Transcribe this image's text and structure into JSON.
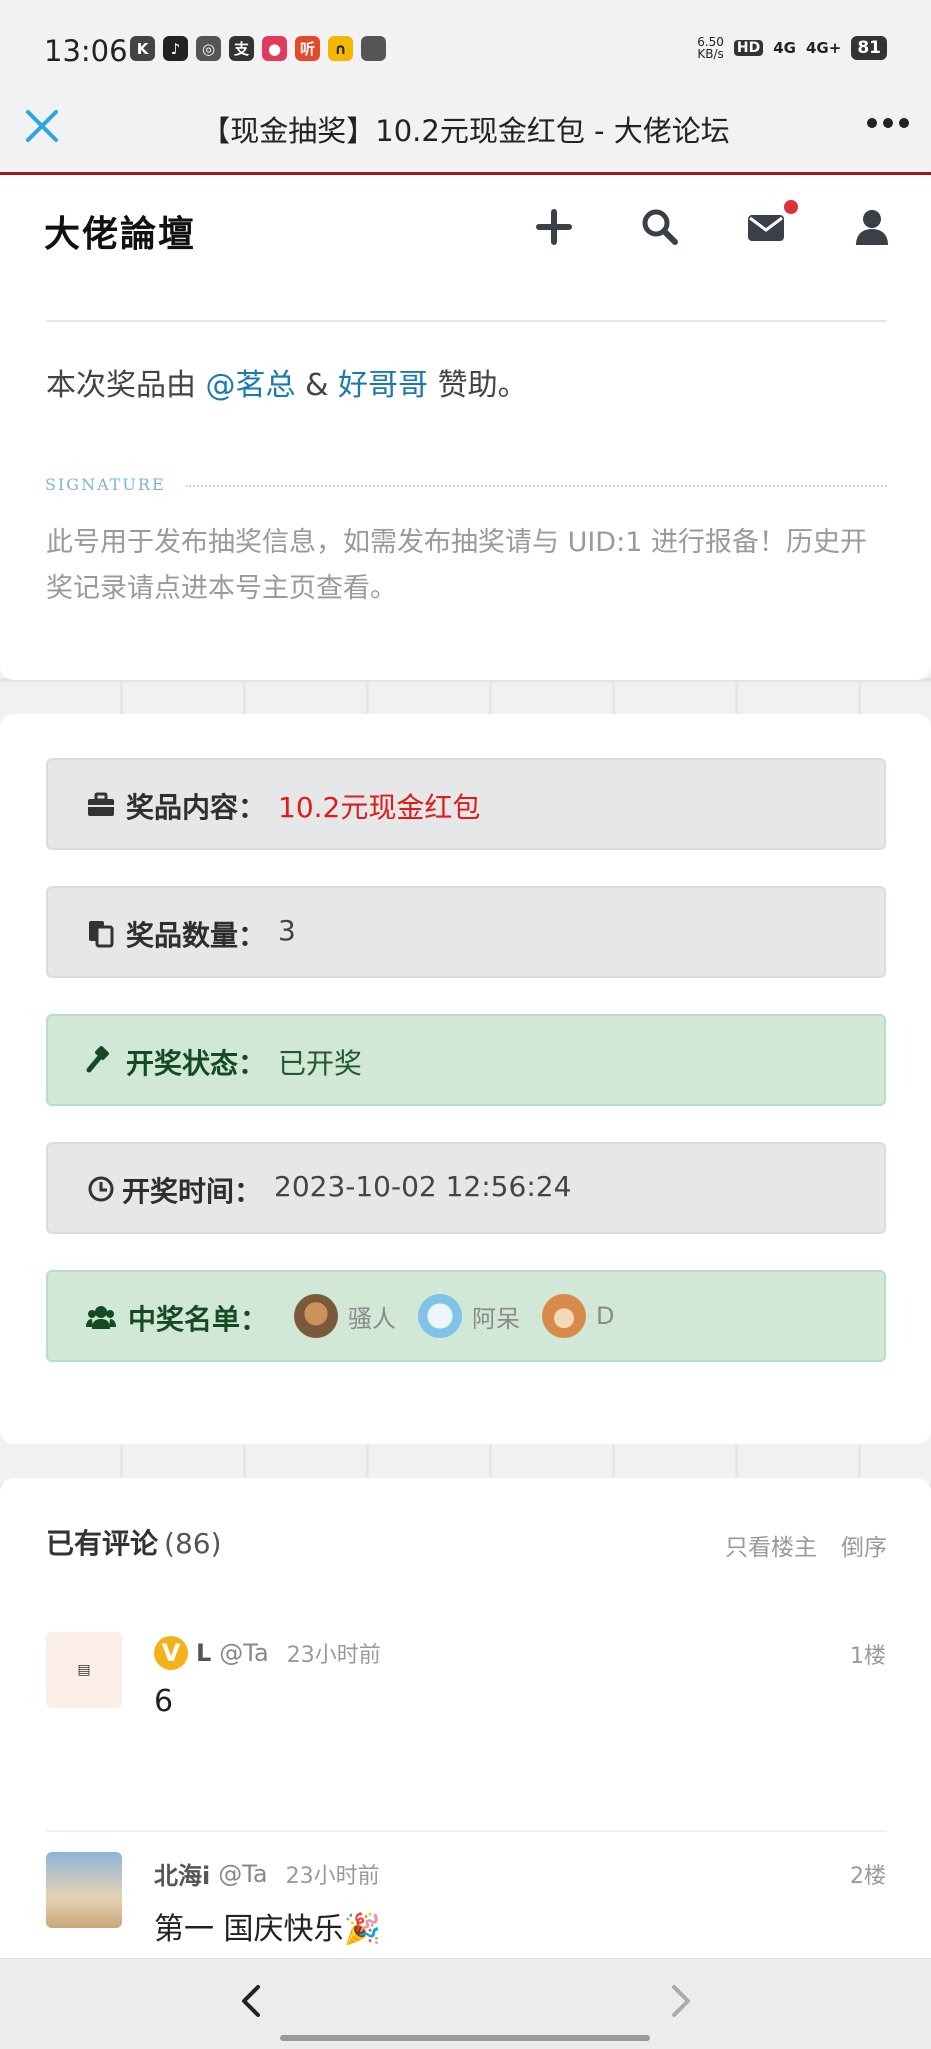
{
  "status_bar": {
    "time": "13:06",
    "net_speed": "6.50",
    "net_speed_unit": "KB/s",
    "hd": "HD",
    "signal1": "4G",
    "signal2": "4G+",
    "battery": "81"
  },
  "titlebar": {
    "title": "【现金抽奖】10.2元现金红包 - 大佬论坛"
  },
  "site": {
    "logo": "大佬論壇"
  },
  "post": {
    "sponsor_prefix": "本次奖品由",
    "sponsor1": "@茗总",
    "sponsor_amp": "&",
    "sponsor2": "好哥哥",
    "sponsor_suffix": "赞助。",
    "signature_label": "SIGNATURE",
    "signature_text": "此号用于发布抽奖信息，如需发布抽奖请与 UID:1 进行报备！历史开奖记录请点进本号主页查看。"
  },
  "prize_box": {
    "content_label": "奖品内容：",
    "content_value": "10.2元现金红包",
    "quantity_label": "奖品数量：",
    "quantity_value": "3",
    "status_label": "开奖状态：",
    "status_value": "已开奖",
    "time_label": "开奖时间：",
    "time_value": "2023-10-02 12:56:24",
    "winners_label": "中奖名单：",
    "winners": [
      "骚人",
      "阿呆",
      "D"
    ]
  },
  "comments": {
    "title": "已有评论",
    "count": "(86)",
    "only_op": "只看楼主",
    "reverse": "倒序",
    "items": [
      {
        "name": "L",
        "at": "@Ta",
        "time": "23小时前",
        "floor": "1楼",
        "body": "6"
      },
      {
        "name": "北海i",
        "at": "@Ta",
        "time": "23小时前",
        "floor": "2楼",
        "body": "第一  国庆快乐🎉"
      }
    ]
  },
  "colors": {
    "accent_red": "#a3151b",
    "link_blue": "#1b79b1",
    "prize_red": "#e11a1a",
    "success_bg": "#d2e8d7"
  }
}
